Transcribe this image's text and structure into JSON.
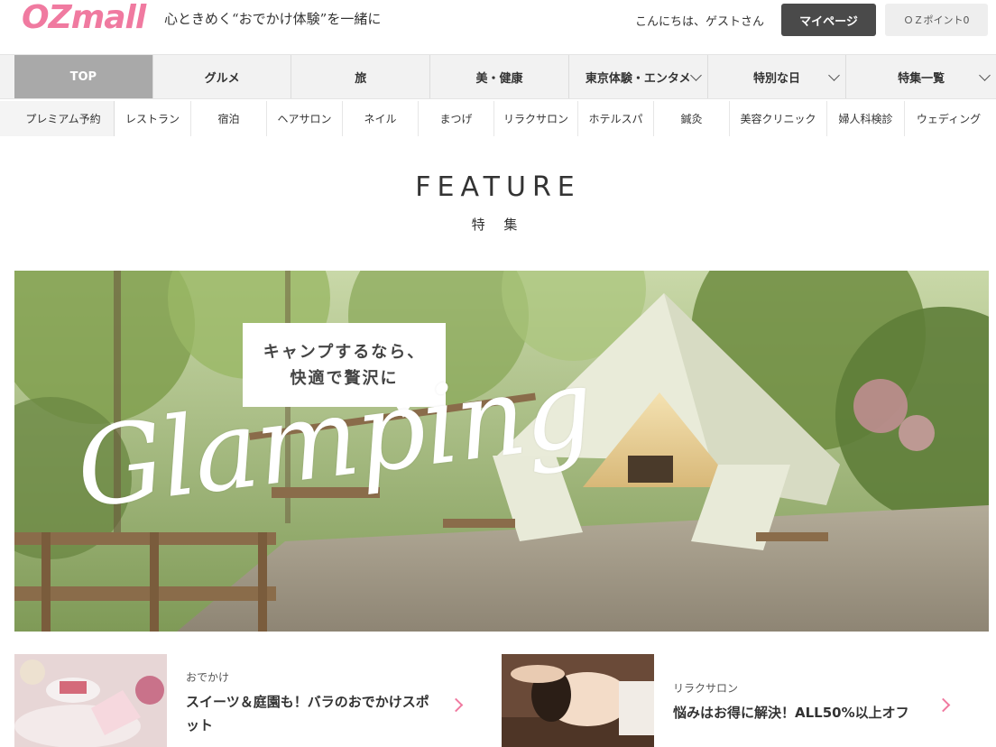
{
  "header": {
    "logo": "OZmall",
    "tagline": "心ときめく“おでかけ体験”を一緒に",
    "greeting": "こんにちは、ゲストさん",
    "mypage_label": "マイページ",
    "points_label": "ＯＺポイント0"
  },
  "main_nav": [
    "TOP",
    "グルメ",
    "旅",
    "美・健康",
    "東京体験・エンタメ",
    "特別な日",
    "特集一覧"
  ],
  "sub_nav": [
    "プレミアム予約",
    "レストラン",
    "宿泊",
    "ヘアサロン",
    "ネイル",
    "まつげ",
    "リラクサロン",
    "ホテルスパ",
    "鍼灸",
    "美容クリニック",
    "婦人科検診",
    "ウェディング"
  ],
  "feature": {
    "title": "FEATURE",
    "subtitle": "特 集"
  },
  "hero": {
    "callout_line1": "キャンプするなら、",
    "callout_line2": "快適で贅沢に",
    "script_text": "Glamping"
  },
  "cards": [
    {
      "category": "おでかけ",
      "title_line1": "スイーツ＆庭園も！バラのおでかけスポ",
      "title_line2": "ット"
    },
    {
      "category": "リラクサロン",
      "title_line1": "悩みはお得に解決！ALL50%以上オフ",
      "title_line2": ""
    }
  ],
  "colors": {
    "brand_pink": "#f07aa0",
    "dark_button": "#4a4a4a",
    "nav_active": "#a9a9a9",
    "nav_bg": "#f2f2f2"
  }
}
